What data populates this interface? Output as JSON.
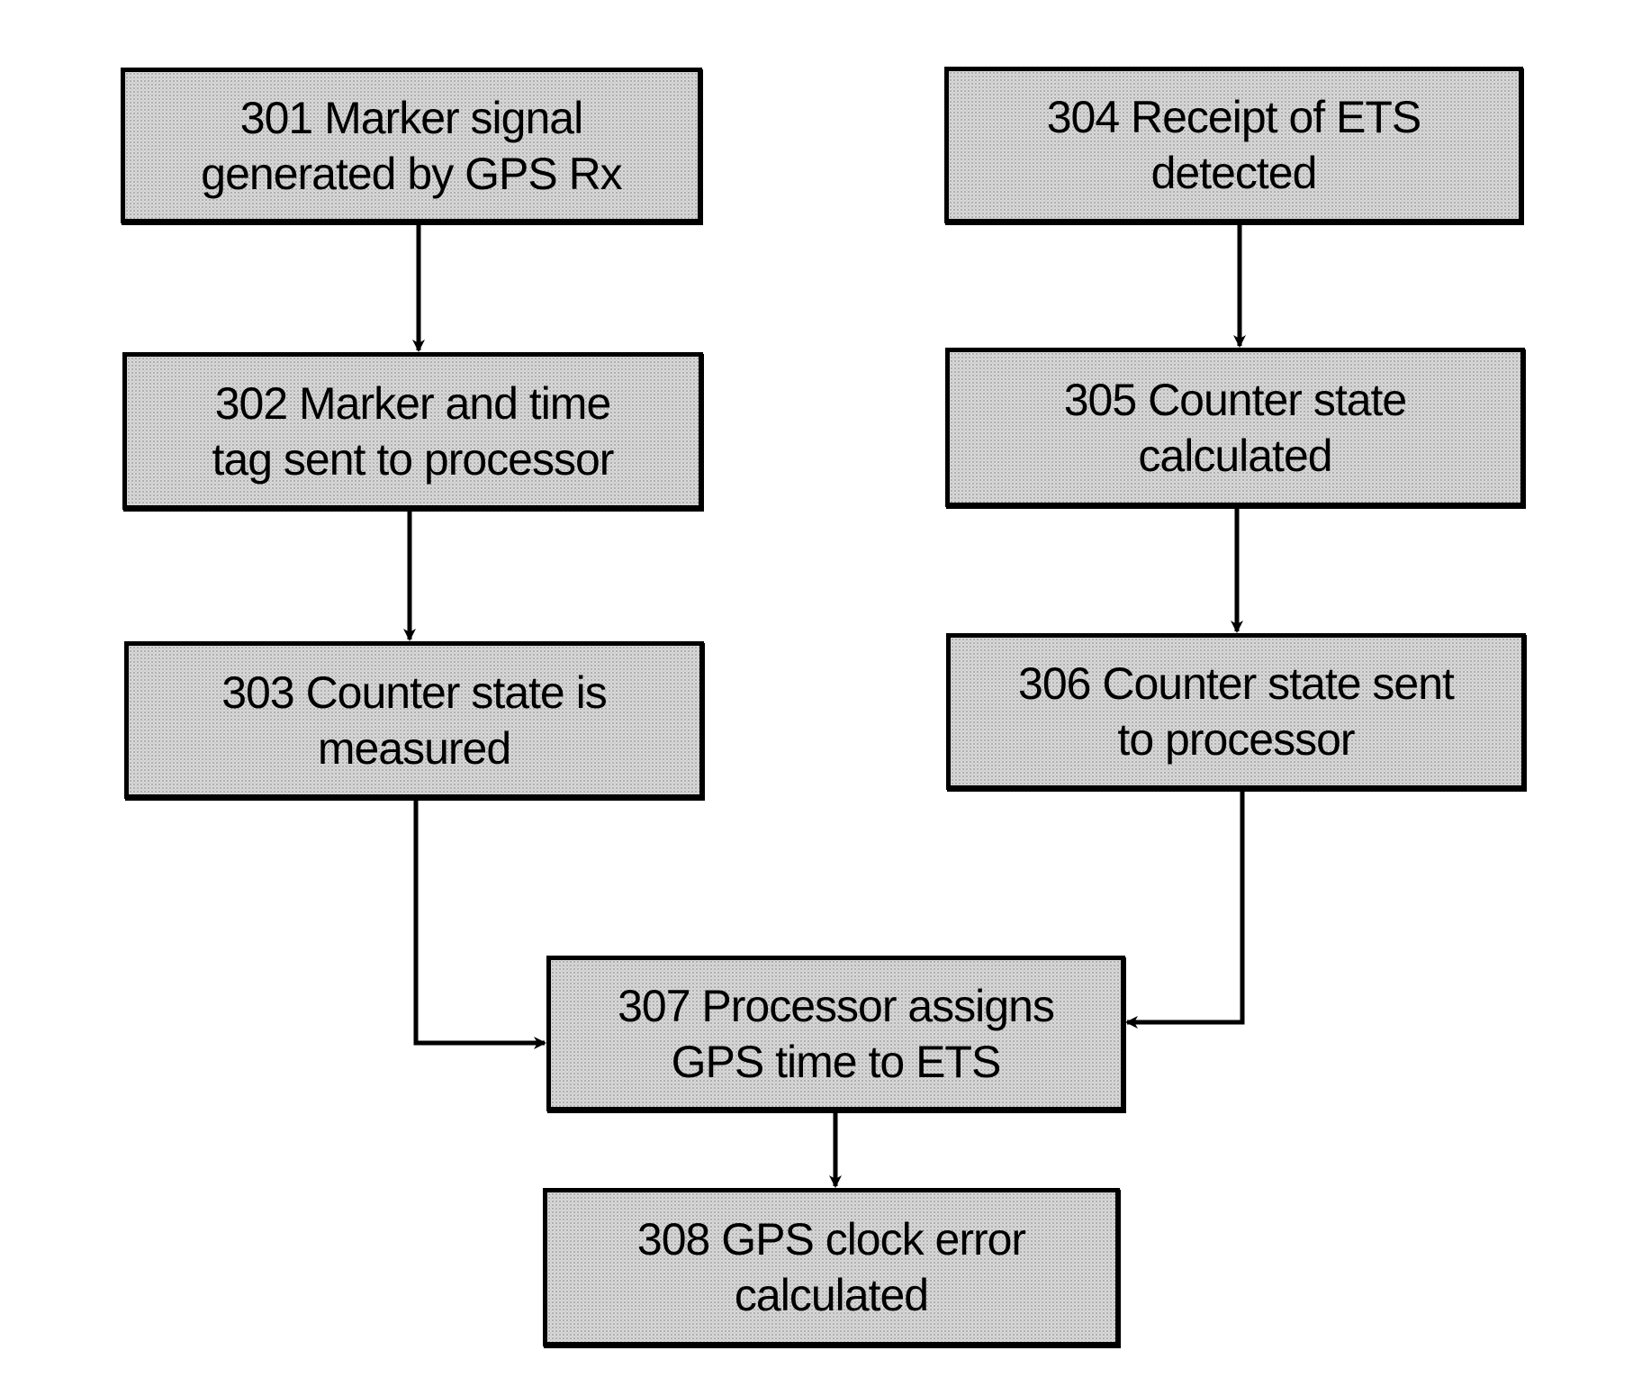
{
  "diagram": {
    "type": "flowchart",
    "nodes": [
      {
        "id": "301",
        "label": "301 Marker signal\ngenerated by GPS Rx"
      },
      {
        "id": "302",
        "label": "302 Marker and time\ntag sent to processor"
      },
      {
        "id": "303",
        "label": "303 Counter state is\nmeasured"
      },
      {
        "id": "304",
        "label": "304 Receipt of ETS\ndetected"
      },
      {
        "id": "305",
        "label": "305 Counter state\ncalculated"
      },
      {
        "id": "306",
        "label": "306 Counter state sent\nto processor"
      },
      {
        "id": "307",
        "label": "307 Processor assigns\nGPS time to ETS"
      },
      {
        "id": "308",
        "label": "308 GPS clock error\ncalculated"
      }
    ],
    "edges": [
      {
        "from": "301",
        "to": "302"
      },
      {
        "from": "302",
        "to": "303"
      },
      {
        "from": "304",
        "to": "305"
      },
      {
        "from": "305",
        "to": "306"
      },
      {
        "from": "303",
        "to": "307"
      },
      {
        "from": "306",
        "to": "307"
      },
      {
        "from": "307",
        "to": "308"
      }
    ]
  }
}
